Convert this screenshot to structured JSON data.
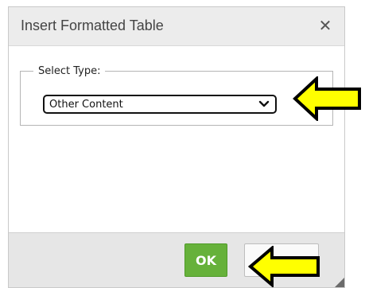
{
  "dialog": {
    "title": "Insert Formatted Table",
    "close_glyph": "✕"
  },
  "type_group": {
    "legend": "Select Type:",
    "select": {
      "selected_value": "Other Content"
    }
  },
  "footer": {
    "ok_label": "OK",
    "cancel_label": ""
  },
  "annotations": {
    "arrow_color": "#ffff00",
    "arrow_outline": "#000000",
    "ok_color": "#66b13a"
  },
  "icons": [
    "close-icon",
    "chevron-down-icon",
    "resize-grip-icon",
    "pointer-arrow-icon"
  ]
}
